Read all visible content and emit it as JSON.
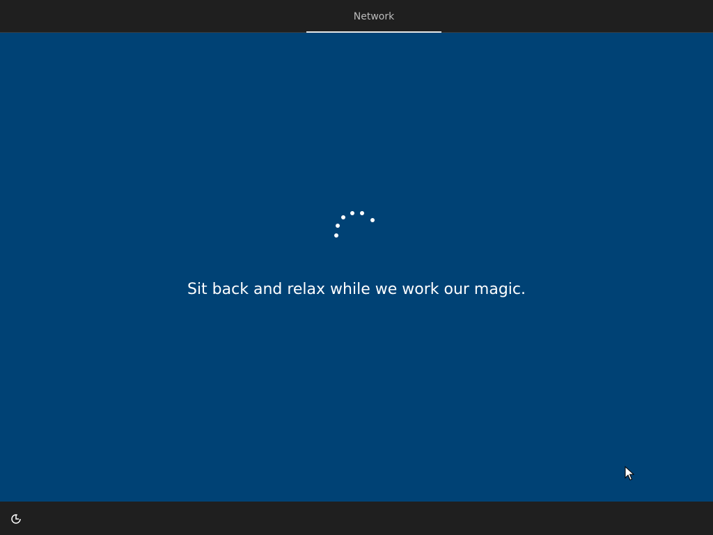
{
  "header": {
    "tabs": [
      {
        "label": "Network",
        "active": true
      }
    ]
  },
  "main": {
    "message": "Sit back and relax while we work our magic.",
    "background_color": "#004275"
  },
  "footer": {
    "ease_of_access_icon": "ease-of-access-icon"
  }
}
